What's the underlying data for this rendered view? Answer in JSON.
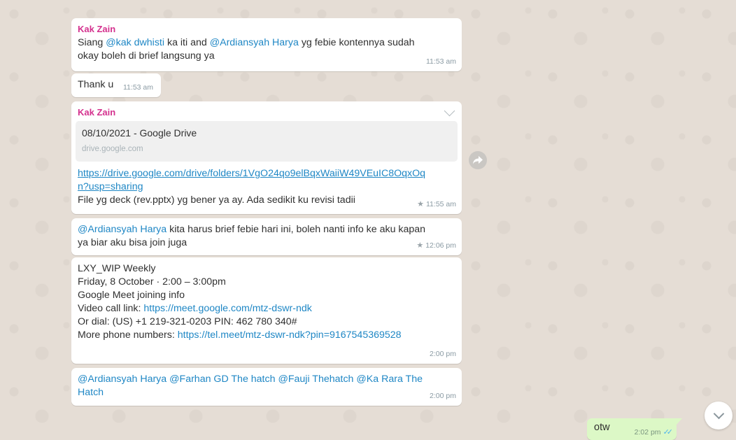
{
  "messages": [
    {
      "sender": "Kak Zain",
      "line1_pre": "Siang ",
      "line1_mention1": "@kak dwhisti",
      "line1_mid": " ka iti and ",
      "line1_mention2": "@Ardiansyah Harya",
      "line1_post": " yg febie kontennya sudah",
      "line2": "okay boleh di brief langsung ya",
      "time": "11:53 am"
    },
    {
      "text": "Thank u",
      "time": "11:53 am"
    },
    {
      "sender": "Kak Zain",
      "preview_title": "08/10/2021 - Google Drive",
      "preview_domain": "drive.google.com",
      "link_line1": "https://drive.google.com/drive/folders/1VgO24qo9elBqxWaiiW49VEuIC8OqxOq",
      "link_line2": "n?usp=sharing",
      "text": " File yg deck (rev.pptx) yg bener ya ay. Ada sedikit ku revisi tadii",
      "star": "★",
      "time": "11:55 am"
    },
    {
      "mention": "@Ardiansyah Harya",
      "text1": " kita harus brief febie hari ini, boleh nanti info ke aku kapan",
      "text2": "ya biar aku bisa join juga",
      "star": "★",
      "time": "12:06 pm"
    },
    {
      "line1": "LXY_WIP Weekly",
      "line2": "Friday, 8 October · 2:00 – 3:00pm",
      "line3": "Google Meet joining info",
      "line4_label": "Video call link: ",
      "line4_link": "https://meet.google.com/mtz-dswr-ndk",
      "line5": "Or dial: (US) +1 219-321-0203 PIN: 462 780 340#",
      "line6_label": "More phone numbers: ",
      "line6_link": "https://tel.meet/mtz-dswr-ndk?pin=9167545369528",
      "time": "2:00 pm"
    },
    {
      "m1": "@Ardiansyah Harya",
      "m2": "@Farhan GD The hatch",
      "m3": "@Fauji Thehatch",
      "m4": "@Ka Rara The",
      "m4b": "Hatch",
      "time": "2:00 pm"
    }
  ],
  "outgoing": {
    "text": "otw",
    "time": "2:02 pm",
    "ticks": "✓✓"
  },
  "icons": {
    "forward": "forward-icon",
    "scroll_down": "chevron-down-icon",
    "menu": "chevron-down-icon"
  },
  "colors": {
    "sender": "#d4318e",
    "mention": "#1f87c5",
    "outgoing_bg": "#dcf8c6",
    "chat_bg": "#e5ddd5"
  }
}
